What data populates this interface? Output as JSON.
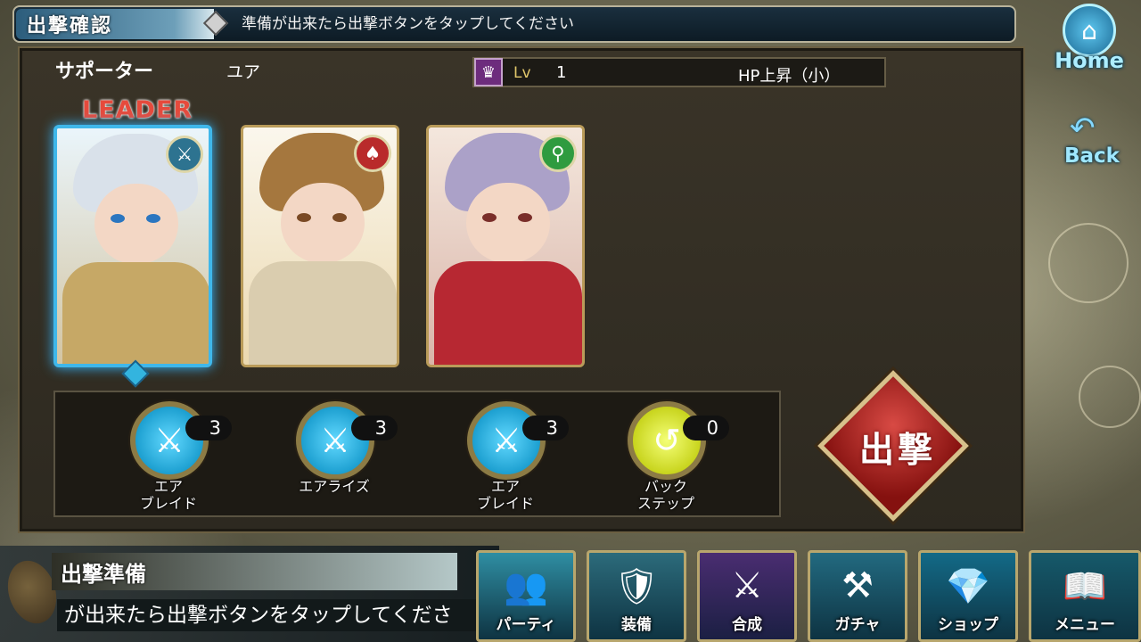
{
  "header": {
    "title": "出撃確認",
    "message": "準備が出来たら出撃ボタンをタップしてください"
  },
  "support": {
    "label": "サポーター",
    "name": "ユア",
    "skill_icon": "shield-icon",
    "level_label": "Lv",
    "level": "1",
    "skill_name": "HP上昇（小）"
  },
  "leader_label": "LEADER",
  "party": [
    {
      "class_icon": "sword-icon",
      "hair": "#d9e1ea",
      "body": "#c6a866",
      "eye": "#2b76c0"
    },
    {
      "class_icon": "spear-shield-icon",
      "hair": "#a5773e",
      "body": "#dacdaf",
      "eye": "#7a4a25"
    },
    {
      "class_icon": "staff-icon",
      "hair": "#aba1c8",
      "body": "#b72832",
      "eye": "#7a2e2a"
    }
  ],
  "skills": [
    {
      "icon": "air-blade-icon",
      "count": "3",
      "label": "エア\nブレイド",
      "color": "#1c9fd0"
    },
    {
      "icon": "air-rise-icon",
      "count": "3",
      "label": "エアライズ",
      "color": "#1c9fd0"
    },
    {
      "icon": "air-blade-icon",
      "count": "3",
      "label": "エア\nブレイド",
      "color": "#1c9fd0"
    },
    {
      "icon": "backstep-icon",
      "count": "0",
      "label": "バック\nステップ",
      "color": "#c8d41d"
    }
  ],
  "sortie_button": "出撃",
  "home": {
    "label": "Home",
    "icon": "home-icon"
  },
  "back": {
    "label": "Back",
    "icon": "back-arrow-icon"
  },
  "status": {
    "title": "出撃準備",
    "message": "が出来たら出撃ボタンをタップしてくださ"
  },
  "nav": [
    {
      "label": "パーティ",
      "icon": "party-icon",
      "color": "#2f8ea3"
    },
    {
      "label": "装備",
      "icon": "equipment-icon",
      "color": "#2c6b7b"
    },
    {
      "label": "合成",
      "icon": "synthesis-icon",
      "color": "#4a2d71"
    },
    {
      "label": "ガチャ",
      "icon": "gacha-icon",
      "color": "#226a80"
    },
    {
      "label": "ショップ",
      "icon": "shop-icon",
      "color": "#136a87"
    },
    {
      "label": "メニュー",
      "icon": "menu-book-icon",
      "color": "#16596a"
    }
  ]
}
